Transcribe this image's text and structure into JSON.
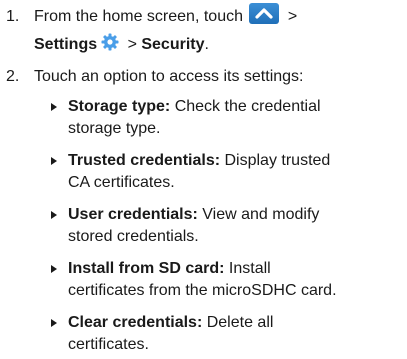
{
  "step1": {
    "number": "1.",
    "text_before": "From the home screen, touch ",
    "after_apps": " >",
    "settings_label": "Settings",
    "separator": " > ",
    "security_label": "Security",
    "end": ".",
    "apps_icon": "chevron-up-icon",
    "settings_icon": "gear-icon"
  },
  "step2": {
    "number": "2.",
    "text": "Touch an option to access its settings:"
  },
  "options": [
    {
      "title": "Storage type:",
      "desc_line1": " Check the credential",
      "desc_line2": "storage type."
    },
    {
      "title": "Trusted credentials:",
      "desc_line1": " Display trusted",
      "desc_line2": "CA certificates."
    },
    {
      "title": "User credentials:",
      "desc_line1": " View and modify",
      "desc_line2": "stored credentials."
    },
    {
      "title": "Install from SD card:",
      "desc_line1": " Install",
      "desc_line2": "certificates from the microSDHC card."
    },
    {
      "title": "Clear credentials:",
      "desc_line1": " Delete all",
      "desc_line2": "certificates."
    }
  ],
  "colors": {
    "text": "#1a1a1a",
    "apps_icon_bg": "#2a7fcc",
    "settings_icon": "#4a9ee8"
  }
}
